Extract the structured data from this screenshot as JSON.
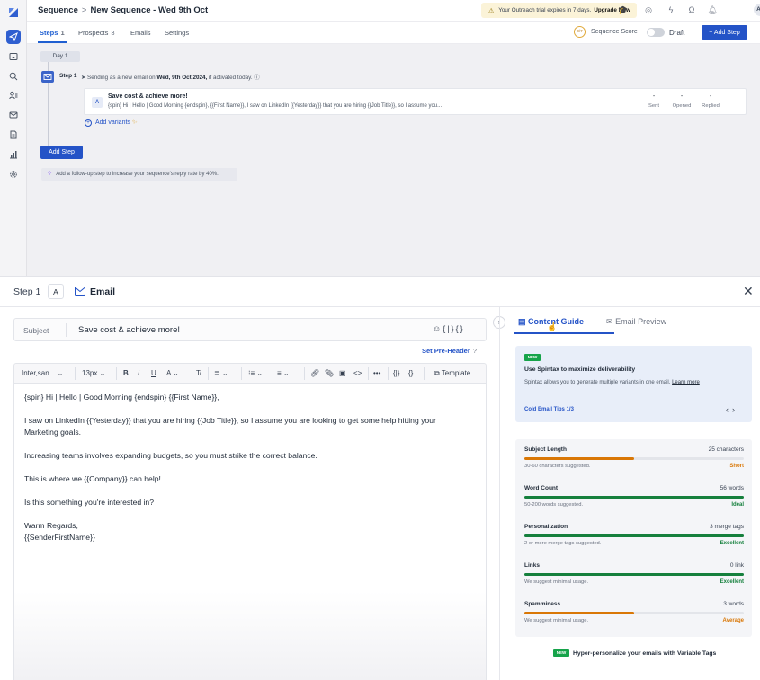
{
  "header": {
    "breadcrumb_root": "Sequence",
    "breadcrumb_sep": ">",
    "breadcrumb_current": "New Sequence - Wed 9th Oct",
    "trial_text": "Your Outreach trial expires in 7 days.",
    "trial_link": "Upgrade Now",
    "avatar_initials": "AG"
  },
  "tabs": [
    {
      "label": "Steps",
      "count": "1"
    },
    {
      "label": "Prospects",
      "count": "3"
    },
    {
      "label": "Emails",
      "count": ""
    },
    {
      "label": "Settings",
      "count": ""
    }
  ],
  "sequence_bar": {
    "score_value": "0/7",
    "score_label": "Sequence Score",
    "toggle_on": false,
    "draft_label": "Draft",
    "add_step_label": "+ Add Step"
  },
  "workspace": {
    "day_label": "Day 1",
    "step_label": "Step 1",
    "send_note_prefix": "Sending as a new email on",
    "send_note_date": "Wed, 9th Oct 2024,",
    "send_note_suffix": "if activated today.",
    "card": {
      "variant": "A",
      "subject": "Save cost & achieve more!",
      "preview": "{spin} Hi | Hello | Good Morning {endspin}, {{First Name}}, I saw on LinkedIn {{Yesterday}} that you are hiring {{Job Title}}, so I assume you...",
      "stats": [
        {
          "label": "Sent",
          "value": "-"
        },
        {
          "label": "Opened",
          "value": "-"
        },
        {
          "label": "Replied",
          "value": "-"
        }
      ]
    },
    "add_variants_label": "Add variants",
    "add_step_label": "Add Step",
    "followup_tip": "Add a follow-up step to increase your sequence's reply rate by 40%."
  },
  "editor": {
    "step_label": "Step 1",
    "variant": "A",
    "channel": "Email",
    "subject_label": "Subject",
    "subject_value": "Save cost & achieve more!",
    "preheader_label": "Set Pre-Header",
    "toolbar": {
      "font": "Inter,san...",
      "size": "13px",
      "template_label": "Template"
    },
    "body_lines": [
      "{spin} Hi | Hello | Good Morning {endspin} {{First Name}},",
      "I saw on LinkedIn {{Yesterday}} that you are hiring {{Job Title}}, so I assume you are looking to get some help hitting your",
      "Marketing goals.",
      "Increasing teams involves expanding budgets, so you must strike the correct balance.",
      "This is where we {{Company}} can help!",
      "Is this something you're interested in?",
      "Warm Regards,",
      "{{SenderFirstName}}"
    ]
  },
  "guide": {
    "tab_content": "Content Guide",
    "tab_preview": "Email Preview",
    "tip": {
      "badge": "NEW",
      "title": "Use Spintax to maximize deliverability",
      "body": "Spintax allows you to generate multiple variants in one email.",
      "link": "Learn more",
      "footer": "Cold Email Tips 1/3"
    },
    "metrics": [
      {
        "name": "Subject Length",
        "value": "25 characters",
        "hint": "30-60 characters suggested.",
        "status": "Short",
        "fill": 0.5,
        "color": "#d97706"
      },
      {
        "name": "Word Count",
        "value": "56 words",
        "hint": "50-200 words suggested.",
        "status": "Ideal",
        "fill": 1.0,
        "color": "#15803d"
      },
      {
        "name": "Personalization",
        "value": "3 merge tags",
        "hint": "2 or more merge tags suggested.",
        "status": "Excellent",
        "fill": 1.0,
        "color": "#15803d"
      },
      {
        "name": "Links",
        "value": "0 link",
        "hint": "We suggest minimal usage.",
        "status": "Excellent",
        "fill": 1.0,
        "color": "#15803d"
      },
      {
        "name": "Spamminess",
        "value": "3 words",
        "hint": "We suggest minimal usage.",
        "status": "Average",
        "fill": 0.5,
        "color": "#d97706"
      }
    ],
    "hyper_badge": "NEW",
    "hyper_text": "Hyper-personalize your emails with Variable Tags"
  }
}
